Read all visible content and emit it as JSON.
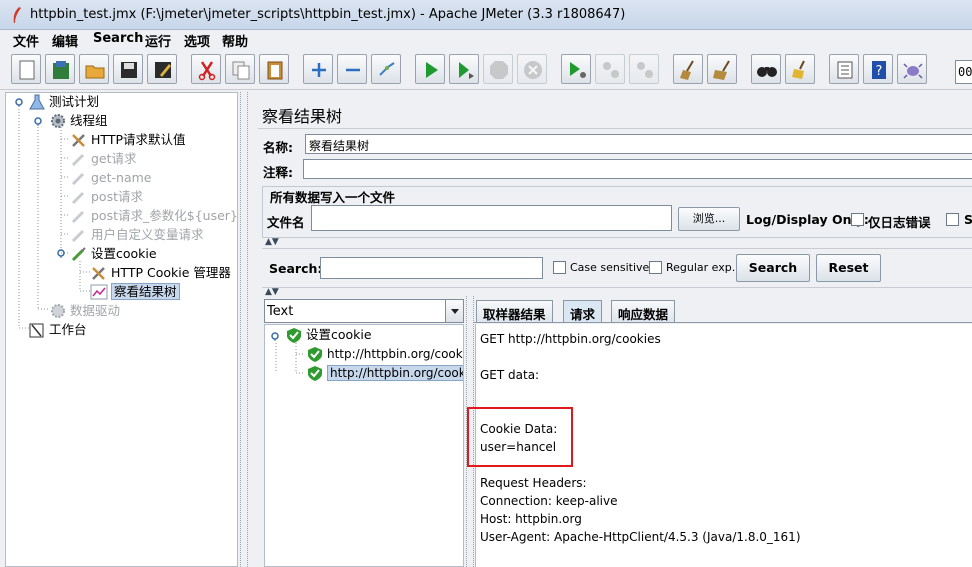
{
  "window": {
    "title": "httpbin_test.jmx (F:\\jmeter\\jmeter_scripts\\httpbin_test.jmx) - Apache JMeter (3.3 r1808647)"
  },
  "menu": [
    "文件",
    "编辑",
    "Search",
    "运行",
    "选项",
    "帮助"
  ],
  "toolbar": {
    "buttons": [
      "new",
      "templates",
      "open",
      "save",
      "save-as",
      "cut",
      "copy",
      "paste",
      "expand",
      "collapse",
      "toggle",
      "start",
      "start-no-pause",
      "stop",
      "shutdown",
      "remote-start",
      "remote-stop",
      "remote-shutdown",
      "clear",
      "clear-all",
      "search",
      "reset-search",
      "function-helper",
      "help",
      "log-viewer"
    ],
    "counter": "00"
  },
  "tree": {
    "items": [
      {
        "label": "测试计划",
        "icon": "flask-icon",
        "enabled": true
      },
      {
        "label": "线程组",
        "icon": "gear-icon",
        "enabled": true
      },
      {
        "label": "HTTP请求默认值",
        "icon": "wrench-icon",
        "enabled": true
      },
      {
        "label": "get请求",
        "icon": "pipette-icon",
        "enabled": false
      },
      {
        "label": "get-name",
        "icon": "pipette-icon",
        "enabled": false
      },
      {
        "label": "post请求",
        "icon": "pipette-icon",
        "enabled": false
      },
      {
        "label": "post请求_参数化${user}",
        "icon": "pipette-icon",
        "enabled": false
      },
      {
        "label": "用户自定义变量请求",
        "icon": "pipette-icon",
        "enabled": false
      },
      {
        "label": "设置cookie",
        "icon": "pipette-icon",
        "enabled": true
      },
      {
        "label": "HTTP Cookie 管理器",
        "icon": "wrench-icon",
        "enabled": true
      },
      {
        "label": "察看结果树",
        "icon": "graph-icon",
        "enabled": true
      },
      {
        "label": "数据驱动",
        "icon": "gear-icon",
        "enabled": false
      },
      {
        "label": "工作台",
        "icon": "workbench-icon",
        "enabled": true
      }
    ]
  },
  "panel": {
    "title": "察看结果树",
    "name_label": "名称:",
    "name_value": "察看结果树",
    "comment_label": "注释:",
    "comment_value": "",
    "file_group_title": "所有数据写入一个文件",
    "filename_label": "文件名",
    "filename_value": "",
    "browse_label": "浏览...",
    "log_display_label": "Log/Display Only:",
    "errors_only_label": "仅日志错误",
    "successes_label": "S"
  },
  "search": {
    "label": "Search:",
    "value": "",
    "case_sensitive": "Case sensitive",
    "regular_exp": "Regular exp.",
    "search_button": "Search",
    "reset_button": "Reset"
  },
  "results": {
    "renderer": "Text",
    "tree": [
      {
        "label": "设置cookie",
        "level": 0
      },
      {
        "label": "http://httpbin.org/cookies/",
        "level": 1
      },
      {
        "label": "http://httpbin.org/cookies",
        "level": 1,
        "selected": true
      }
    ]
  },
  "tabs": [
    "取样器结果",
    "请求",
    "响应数据"
  ],
  "active_tab": "请求",
  "request": {
    "line1": "GET http://httpbin.org/cookies",
    "line2": "GET data:",
    "line3": "Cookie Data:",
    "line4": "user=hancel",
    "line5": "Request Headers:",
    "line6": "Connection: keep-alive",
    "line7": "Host: httpbin.org",
    "line8": "User-Agent: Apache-HttpClient/4.5.3 (Java/1.8.0_161)"
  },
  "colors": {
    "highlight": "#e2191c",
    "success": "#2f9a2f"
  }
}
